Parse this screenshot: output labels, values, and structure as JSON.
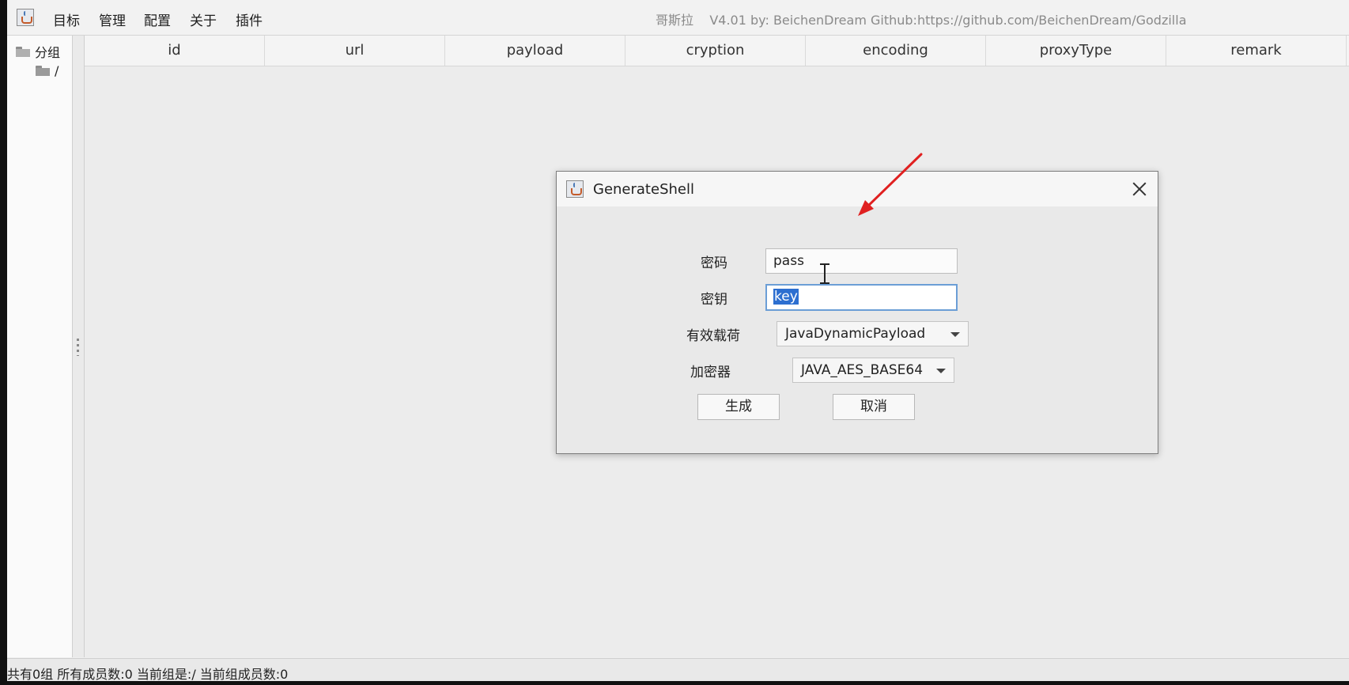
{
  "menubar": {
    "items": [
      "目标",
      "管理",
      "配置",
      "关于",
      "插件"
    ],
    "window_title": "哥斯拉    V4.01 by: BeichenDream Github:https://github.com/BeichenDream/Godzilla"
  },
  "tree": {
    "root_label": "分组",
    "child_label": "/"
  },
  "table": {
    "columns": [
      "id",
      "url",
      "payload",
      "cryption",
      "encoding",
      "proxyType",
      "remark"
    ]
  },
  "status_bar": {
    "text": "共有0组 所有成员数:0 当前组是:/ 当前组成员数:0"
  },
  "dialog": {
    "title": "GenerateShell",
    "password_label": "密码",
    "password_value": "pass",
    "key_label": "密钥",
    "key_value": "key",
    "payload_label": "有效载荷",
    "payload_value": "JavaDynamicPayload",
    "cryption_label": "加密器",
    "cryption_value": "JAVA_AES_BASE64",
    "generate_label": "生成",
    "cancel_label": "取消"
  },
  "colors": {
    "annotation_arrow": "#e02020",
    "selection": "#2d6fd0",
    "focus_border": "#6b9ed6"
  },
  "icons": [
    "java-app-icon",
    "folder-icon",
    "close-icon",
    "dropdown-arrow-icon",
    "text-cursor-icon",
    "annotation-arrow"
  ]
}
